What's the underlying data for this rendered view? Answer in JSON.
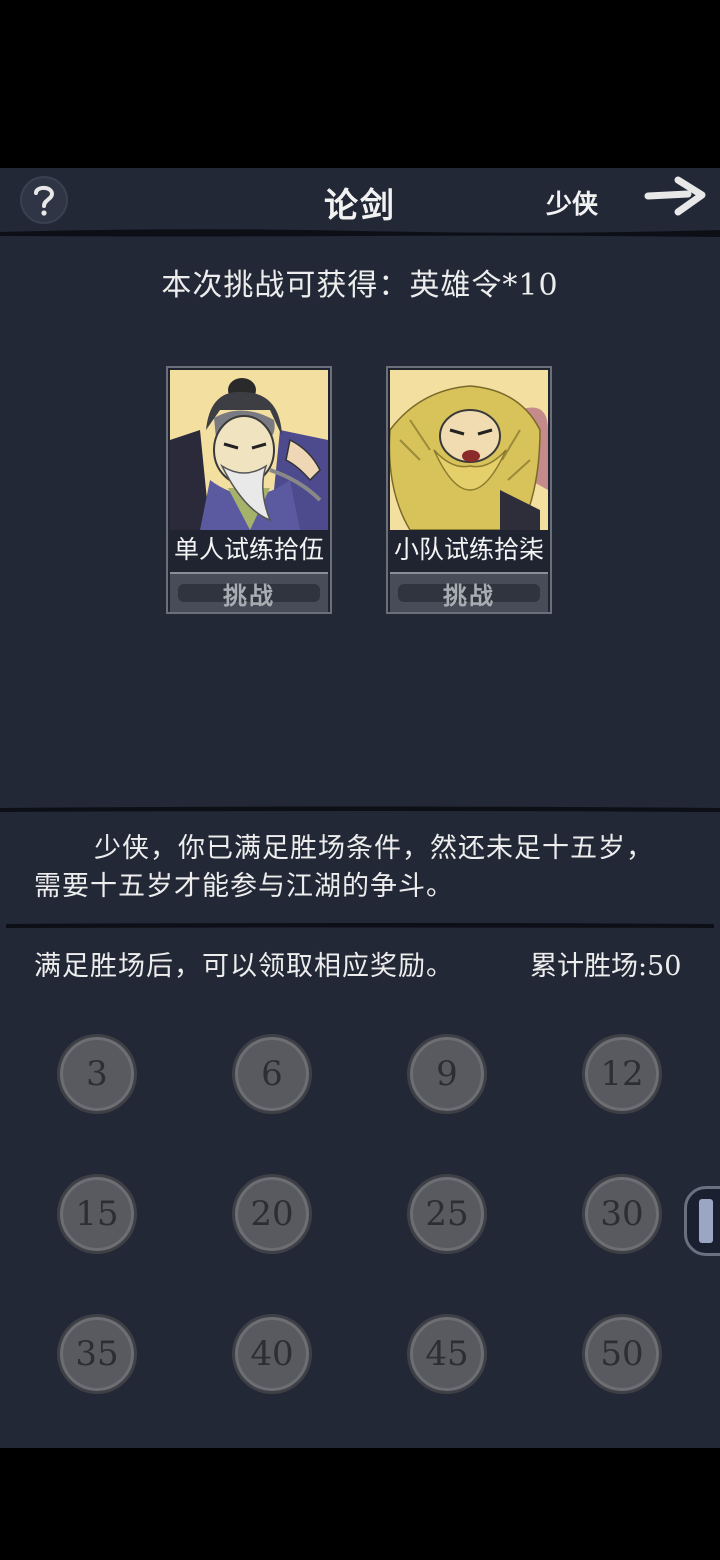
{
  "header": {
    "help_icon": "question-mark-icon",
    "title": "论剑",
    "player_name": "少侠",
    "exit_icon": "arrow-right-icon"
  },
  "reward_text": "本次挑战可获得：英雄令*10",
  "challenges": [
    {
      "name": "单人试练拾伍",
      "button_label": "挑战",
      "portrait": "old-master-portrait"
    },
    {
      "name": "小队试练拾柒",
      "button_label": "挑战",
      "portrait": "blond-warrior-portrait"
    }
  ],
  "message": {
    "line1": "少侠，你已满足胜场条件，然还未足十五岁，",
    "line2": "需要十五岁才能参与江湖的争斗。"
  },
  "rewards_tip": "满足胜场后，可以领取相应奖励。",
  "wins": {
    "label": "累计胜场:",
    "value": "50"
  },
  "milestones": [
    "3",
    "6",
    "9",
    "12",
    "15",
    "20",
    "25",
    "30",
    "35",
    "40",
    "45",
    "50"
  ],
  "colors": {
    "background": "#222836",
    "card_bg": "#f3dfa0",
    "milestone": "#585a5f"
  }
}
